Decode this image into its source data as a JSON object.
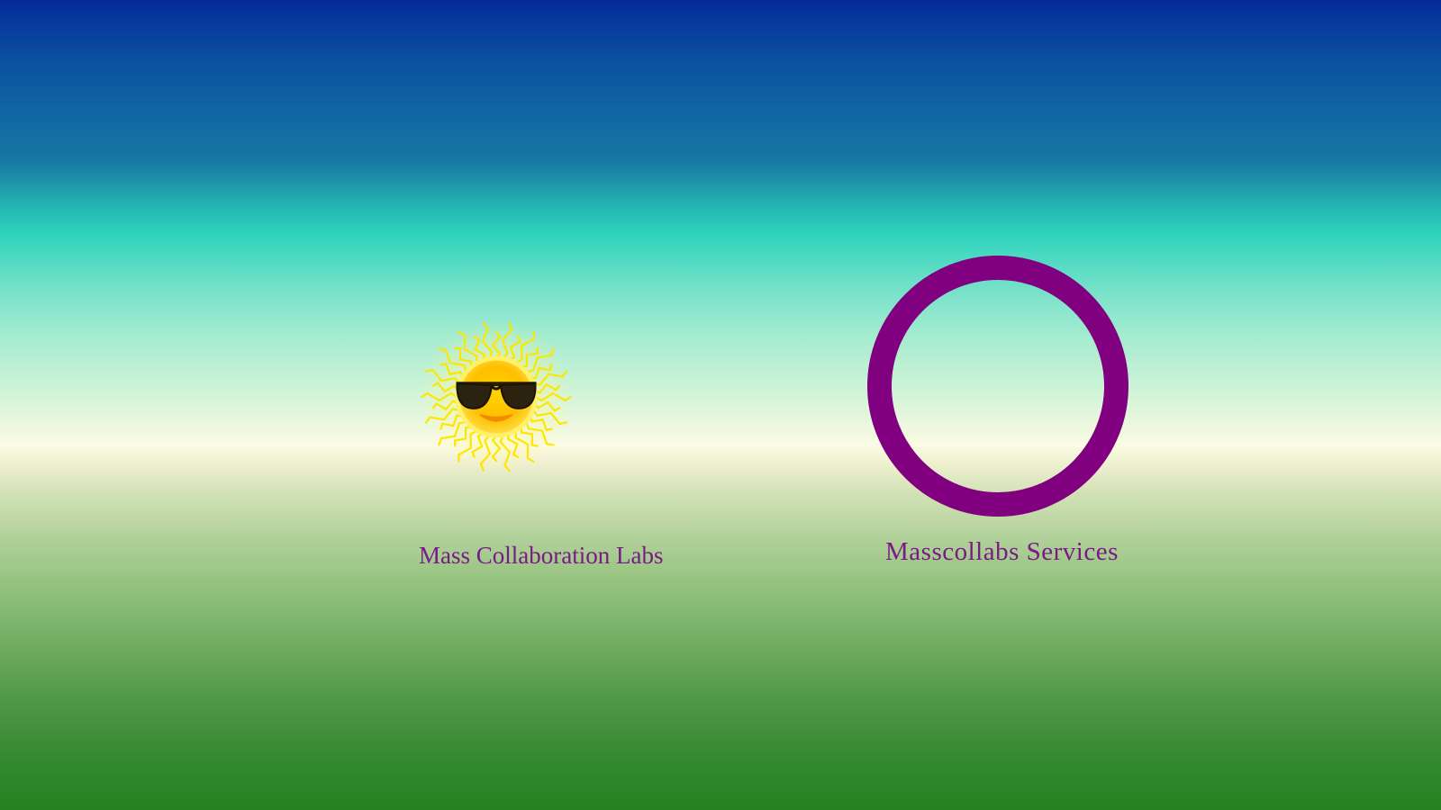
{
  "links": [
    {
      "label": "Mass Collaboration Labs",
      "icon": "sunglasses-sun-icon"
    },
    {
      "label": "Masscollabs Services",
      "icon": "purple-ring-icon"
    }
  ],
  "colors": {
    "caption": "#7a1a86",
    "ring": "#800080",
    "sun": "#ffe600",
    "sky_top": "#032a9a",
    "horizon": "#fcfbe4",
    "ground_bottom": "#23821f"
  }
}
